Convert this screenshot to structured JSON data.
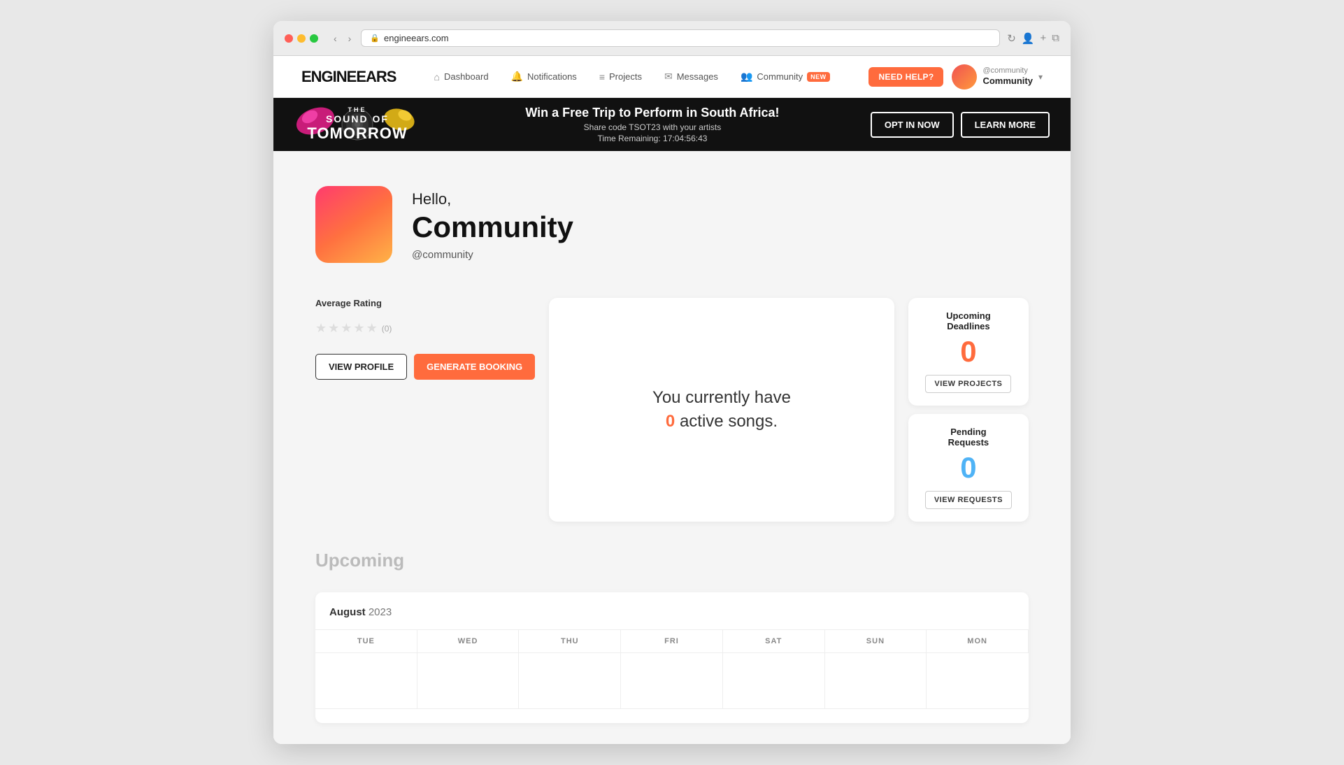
{
  "browser": {
    "url": "engineears.com",
    "reload_icon": "↻"
  },
  "nav": {
    "logo": "ENGINEEARS",
    "links": [
      {
        "id": "dashboard",
        "icon": "⌂",
        "label": "Dashboard"
      },
      {
        "id": "notifications",
        "icon": "🔔",
        "label": "Notifications"
      },
      {
        "id": "projects",
        "icon": "≡",
        "label": "Projects"
      },
      {
        "id": "messages",
        "icon": "✉",
        "label": "Messages"
      },
      {
        "id": "community",
        "icon": "👥",
        "label": "Community",
        "badge": "NEW"
      }
    ],
    "need_help": "NEED HELP?",
    "user": {
      "handle": "@community",
      "name": "Community"
    }
  },
  "banner": {
    "logo_line1": "THE",
    "logo_line2": "SOUND OF",
    "logo_line3": "TOMORROW",
    "title": "Win a Free Trip to Perform in South Africa!",
    "subtitle": "Share code TSOT23 with your artists",
    "timer_label": "Time Remaining:",
    "timer_value": "17:04:56:43",
    "btn_opt_in": "OPT IN NOW",
    "btn_learn_more": "LEARN MORE"
  },
  "profile": {
    "greeting": "Hello,",
    "name": "Community",
    "handle": "@community"
  },
  "rating": {
    "label": "Average Rating",
    "count": "(0)"
  },
  "buttons": {
    "view_profile": "VIEW PROFILE",
    "generate_booking": "GENERATE BOOKING"
  },
  "active_songs": {
    "prefix": "You currently have",
    "count": "0",
    "suffix": "active songs."
  },
  "stats": {
    "deadlines": {
      "title": "Upcoming\nDeadlines",
      "value": "0",
      "btn": "VIEW PROJECTS"
    },
    "requests": {
      "title": "Pending\nRequests",
      "value": "0",
      "btn": "VIEW REQUESTS"
    }
  },
  "upcoming": {
    "label": "Upcoming"
  },
  "calendar": {
    "month": "August",
    "year": "2023",
    "days": [
      "TUE",
      "WED",
      "THU",
      "FRI",
      "SAT",
      "SUN",
      "MON"
    ]
  }
}
